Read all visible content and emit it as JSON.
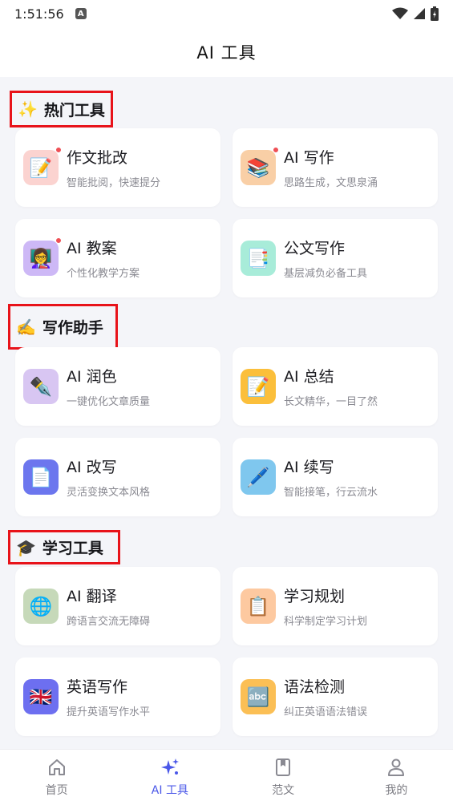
{
  "status_bar": {
    "time": "1:51:56",
    "notification_badge": "A"
  },
  "header": {
    "title": "AI 工具"
  },
  "sections": [
    {
      "title": "热门工具",
      "icon": "sparkle-icon",
      "emoji": "✨",
      "cards": [
        {
          "title": "作文批改",
          "subtitle": "智能批阅，快速提分",
          "icon": "memo-icon",
          "emoji": "📝",
          "has_dot": true,
          "bg": "#fbd3d0"
        },
        {
          "title": "AI 写作",
          "subtitle": "思路生成，文思泉涌",
          "icon": "books-icon",
          "emoji": "📚",
          "has_dot": true,
          "bg": "#f9cfa6"
        },
        {
          "title": "AI 教案",
          "subtitle": "个性化教学方案",
          "icon": "teacher-icon",
          "emoji": "👩‍🏫",
          "has_dot": true,
          "bg": "#cdb8f6"
        },
        {
          "title": "公文写作",
          "subtitle": "基层减负必备工具",
          "icon": "document-icon",
          "emoji": "📑",
          "has_dot": false,
          "bg": "#a8ecd9"
        }
      ]
    },
    {
      "title": "写作助手",
      "icon": "writing-hand-icon",
      "emoji": "✍️",
      "cards": [
        {
          "title": "AI 润色",
          "subtitle": "一键优化文章质量",
          "icon": "fountain-pen-icon",
          "emoji": "✒️",
          "has_dot": false,
          "bg": "#d8c6f2"
        },
        {
          "title": "AI 总结",
          "subtitle": "长文精华，一目了然",
          "icon": "memo-icon",
          "emoji": "📝",
          "has_dot": false,
          "bg": "#fbbf3b"
        },
        {
          "title": "AI 改写",
          "subtitle": "灵活变换文本风格",
          "icon": "page-icon",
          "emoji": "📄",
          "has_dot": false,
          "bg": "#6c76ee"
        },
        {
          "title": "AI 续写",
          "subtitle": "智能接笔，行云流水",
          "icon": "pen-icon",
          "emoji": "🖊️",
          "has_dot": false,
          "bg": "#7fc7ee"
        }
      ]
    },
    {
      "title": "学习工具",
      "icon": "graduation-cap-icon",
      "emoji": "🎓",
      "cards": [
        {
          "title": "AI 翻译",
          "subtitle": "跨语言交流无障碍",
          "icon": "globe-icon",
          "emoji": "🌐",
          "has_dot": false,
          "bg": "#c6d9b9"
        },
        {
          "title": "学习规划",
          "subtitle": "科学制定学习计划",
          "icon": "clipboard-icon",
          "emoji": "📋",
          "has_dot": false,
          "bg": "#fdc9a0"
        },
        {
          "title": "英语写作",
          "subtitle": "提升英语写作水平",
          "icon": "uk-flag-icon",
          "emoji": "🇬🇧",
          "has_dot": false,
          "bg": "#6d6ff0"
        },
        {
          "title": "语法检测",
          "subtitle": "纠正英语语法错误",
          "icon": "abc-icon",
          "emoji": "🔤",
          "has_dot": false,
          "bg": "#fbbf55"
        }
      ]
    }
  ],
  "bottom_nav": [
    {
      "label": "首页",
      "icon": "home-icon",
      "active": false
    },
    {
      "label": "AI 工具",
      "icon": "ai-sparkle-icon",
      "active": true
    },
    {
      "label": "范文",
      "icon": "bookmark-book-icon",
      "active": false
    },
    {
      "label": "我的",
      "icon": "person-icon",
      "active": false
    }
  ],
  "colors": {
    "accent": "#4a57e8",
    "highlight_box": "#e8131a",
    "badge_dot": "#ef4f55",
    "background": "#f4f5f9"
  }
}
